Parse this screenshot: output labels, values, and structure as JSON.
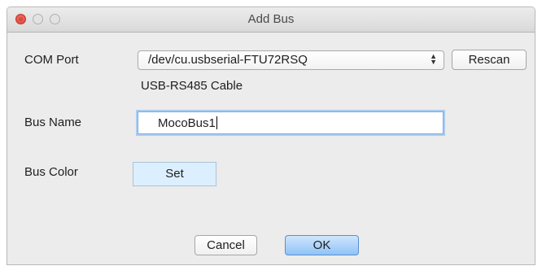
{
  "window": {
    "title": "Add Bus"
  },
  "com_port": {
    "label": "COM Port",
    "selected": "/dev/cu.usbserial-FTU72RSQ",
    "description": "USB-RS485 Cable",
    "rescan_label": "Rescan"
  },
  "bus_name": {
    "label": "Bus Name",
    "value": "MocoBus1"
  },
  "bus_color": {
    "label": "Bus Color",
    "set_label": "Set",
    "swatch_color": "#dcefff"
  },
  "actions": {
    "cancel_label": "Cancel",
    "ok_label": "OK"
  },
  "colors": {
    "close_button": "#ff5f57",
    "default_button": "#8fc3f7",
    "focus_ring": "#a9cdf4"
  },
  "icons": {
    "close": "close-icon",
    "minimize": "minimize-icon",
    "zoom": "zoom-icon",
    "select_arrows": "updown-arrows-icon"
  }
}
